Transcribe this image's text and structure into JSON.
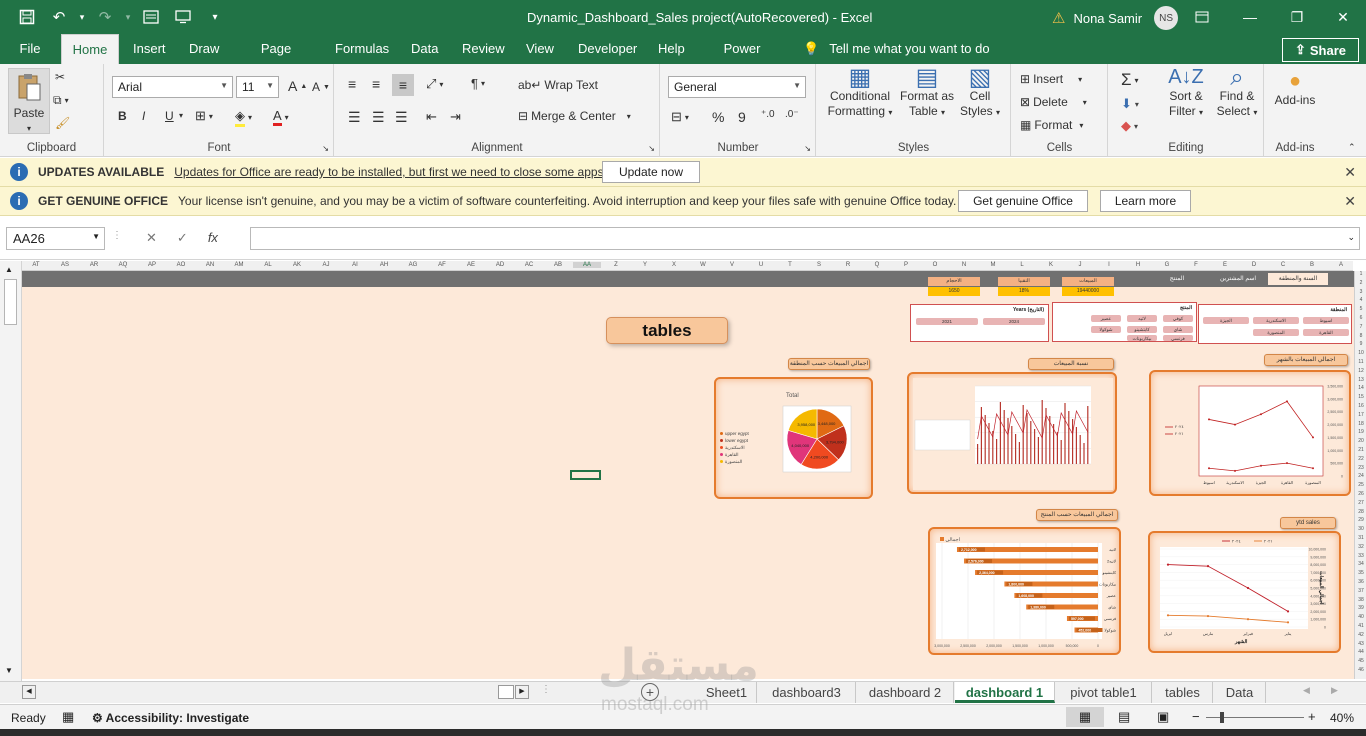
{
  "title_bar": {
    "window_title": "Dynamic_Dashboard_Sales project(AutoRecovered)  -  Excel",
    "user_name": "Nona Samir",
    "user_initials": "NS"
  },
  "ribbon_tabs": [
    "File",
    "Home",
    "Insert",
    "Draw",
    "Page Layout",
    "Formulas",
    "Data",
    "Review",
    "View",
    "Developer",
    "Help",
    "Power Pivot"
  ],
  "active_tab": "Home",
  "tell_me": "Tell me what you want to do",
  "share_label": "Share",
  "clipboard": {
    "paste": "Paste",
    "label": "Clipboard"
  },
  "font": {
    "name": "Arial",
    "size": "11",
    "bold": "B",
    "italic": "I",
    "underline": "U",
    "label": "Font"
  },
  "alignment": {
    "wrap": "Wrap Text",
    "merge": "Merge & Center",
    "label": "Alignment"
  },
  "number": {
    "format": "General",
    "percent": "%",
    "comma": "9",
    "label": "Number"
  },
  "styles": {
    "conditional": [
      "Conditional",
      "Formatting"
    ],
    "format_table": [
      "Format as",
      "Table"
    ],
    "cell_styles": [
      "Cell",
      "Styles"
    ],
    "label": "Styles"
  },
  "cells": {
    "insert": "Insert",
    "delete": "Delete",
    "format": "Format",
    "label": "Cells"
  },
  "editing": {
    "sort": [
      "Sort &",
      "Filter"
    ],
    "find": [
      "Find &",
      "Select"
    ],
    "label": "Editing"
  },
  "addins": {
    "addins": "Add-ins",
    "label": "Add-ins"
  },
  "updates_bar": {
    "title": "UPDATES AVAILABLE",
    "message": "Updates for Office are ready to be installed, but first we need to close some apps.",
    "button": "Update now"
  },
  "genuine_bar": {
    "title": "GET GENUINE OFFICE",
    "message": "Your license isn't genuine, and you may be a victim of software counterfeiting. Avoid interruption and keep your files safe with genuine Office today.",
    "button1": "Get genuine Office",
    "button2": "Learn more"
  },
  "formula_bar": {
    "name_box": "AA26",
    "cancel": "✕",
    "enter": "✓",
    "fx": "fx",
    "formula": ""
  },
  "column_headers": [
    "AT",
    "AS",
    "AR",
    "AQ",
    "AP",
    "AO",
    "AN",
    "AM",
    "AL",
    "AK",
    "AJ",
    "AI",
    "AH",
    "AG",
    "AF",
    "AE",
    "AD",
    "AC",
    "AB",
    "AA",
    "Z",
    "Y",
    "X",
    "W",
    "V",
    "U",
    "T",
    "S",
    "R",
    "Q",
    "P",
    "O",
    "N",
    "M",
    "L",
    "K",
    "J",
    "I",
    "H",
    "G",
    "F",
    "E",
    "D",
    "C",
    "B",
    "A"
  ],
  "row_headers": [
    "1",
    "2",
    "3",
    "4",
    "5",
    "6",
    "7",
    "8",
    "9",
    "10",
    "11",
    "12",
    "13",
    "14",
    "15",
    "16",
    "17",
    "18",
    "19",
    "20",
    "21",
    "22",
    "23",
    "24",
    "25",
    "26",
    "27",
    "28",
    "29",
    "30",
    "31",
    "32",
    "33",
    "34",
    "35",
    "36",
    "37",
    "38",
    "39",
    "40",
    "41",
    "42",
    "43",
    "44",
    "45",
    "46"
  ],
  "dashboard": {
    "tables_button": "tables",
    "header_band": [
      "السنة والمنطقة",
      "اسم المشترين",
      "المنتج"
    ],
    "kpi_labels": [
      "المبيعات",
      "النقبيا",
      "الاحجام"
    ],
    "kpi_values": [
      "19440000",
      "18%",
      "1650"
    ],
    "slicer_years_title": "Years (التاريخ)",
    "slicer_years": [
      "2024",
      "2021"
    ],
    "slicer_product_title": "المنتج",
    "slicer_product": [
      "كوفي",
      "لاتيه",
      "عصير",
      "شاي",
      "كابتشينو",
      "شوكولا",
      "فرنسي",
      "بيكاربونات"
    ],
    "slicer_region_title": "المنطقة",
    "slicer_region": [
      "اسيوط",
      "الاسكندرية",
      "الجيزة",
      "القاهرة",
      "المنصورة"
    ],
    "chart_titles": {
      "pie": "اجمالي المبيعات حسب المنطقة",
      "combo": "نسبة المبيعات",
      "line1": "اجمالي المبيعات بالشهر",
      "bar": "اجمالي المبيعات حسب المنتج",
      "ytd": "ytd sales"
    },
    "pie_title": "Total",
    "bar_legend": "اجمالي",
    "ytd_axis_title": "الشهر",
    "ytd_y_title": "اجمالي المبيعات"
  },
  "chart_data": [
    {
      "type": "pie",
      "title": "Total",
      "categories": [
        "upper egypt",
        "lower egypt",
        "الاسكندرية",
        "القاهرة",
        "المنصورة"
      ],
      "values": [
        3448000,
        3794000,
        4200000,
        4040000,
        3958000
      ],
      "colors": [
        "#e06a14",
        "#c0301c",
        "#f04a20",
        "#e0357a",
        "#f5b900"
      ]
    },
    {
      "type": "bar",
      "title": "اجمالي المبيعات حسب المنتج",
      "categories": [
        "لاتيه",
        "لاتيه2",
        "كابتشينو",
        "بيكاربونات",
        "عصير",
        "شاي",
        "فرنسي",
        "شوكولا"
      ],
      "values": [
        2712000,
        2576000,
        2364000,
        1800000,
        1608000,
        1380000,
        597000,
        452000
      ],
      "labels": [
        "2,712,000",
        "2,576,000",
        "2,364,000",
        "1,800,000",
        "1,608,000",
        "1,380,000",
        "597,000",
        "452,000"
      ],
      "xlim": [
        0,
        3000000
      ]
    },
    {
      "type": "line",
      "title": "اجمالي المبيعات بالشهر",
      "categories": [
        "اسيوط",
        "الاسكندرية",
        "الجيزة",
        "القاهرة",
        "المنصورة"
      ],
      "series": [
        {
          "name": "٢٠٢٤",
          "values": [
            2200000,
            2000000,
            2400000,
            2900000,
            1500000
          ]
        },
        {
          "name": "٢٠٢١",
          "values": [
            300000,
            200000,
            400000,
            500000,
            300000
          ]
        }
      ],
      "ylim": [
        0,
        3500000
      ]
    },
    {
      "type": "line",
      "title": "ytd sales",
      "categories": [
        "ابريل",
        "مارس",
        "فبراير",
        "يناير"
      ],
      "series": [
        {
          "name": "٢٠٢٤",
          "values": [
            8000000,
            7800000,
            5000000,
            2000000
          ]
        },
        {
          "name": "٢٠٢١",
          "values": [
            1500000,
            1400000,
            1000000,
            600000
          ]
        }
      ],
      "ylim": [
        0,
        10000000
      ],
      "xlabel": "الشهر",
      "ylabel": "اجمالي المبيعات"
    }
  ],
  "sheet_tabs": [
    "Sheet1",
    "dashboard3",
    "dashboard 2",
    "dashboard 1",
    "pivot table1",
    "tables",
    "Data"
  ],
  "active_sheet": "dashboard 1",
  "status": {
    "ready": "Ready",
    "accessibility": "Accessibility: Investigate",
    "zoom": "40%"
  },
  "watermark": {
    "arabic": "مستقل",
    "latin": "mostaql.com"
  },
  "colors": {
    "excel_green": "#217346",
    "sheet_bg": "#fde9d9",
    "accent_orange": "#e57b2d"
  }
}
